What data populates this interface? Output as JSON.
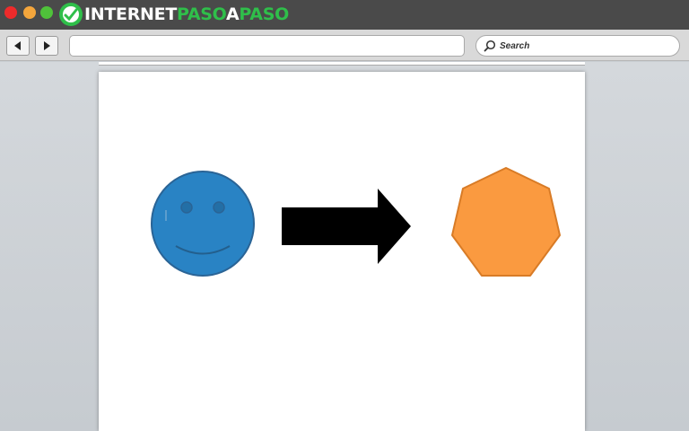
{
  "brand": {
    "logo_part1": "INTERNET",
    "logo_part2": "PASO",
    "logo_part3": "A",
    "logo_part4": "PASO",
    "brand_green": "#2fbf4a"
  },
  "window_controls": [
    "close",
    "minimize",
    "maximize"
  ],
  "toolbar": {
    "back_icon": "back-arrow-icon",
    "forward_icon": "forward-arrow-icon",
    "url_value": "",
    "search_placeholder": "Search"
  },
  "document": {
    "shapes": [
      {
        "name": "smiley-face",
        "fill": "#2983c4",
        "stroke": "#2a6496"
      },
      {
        "name": "right-arrow",
        "fill": "#000000"
      },
      {
        "name": "heptagon",
        "fill": "#fa9a40",
        "stroke": "#d87b26"
      }
    ]
  }
}
